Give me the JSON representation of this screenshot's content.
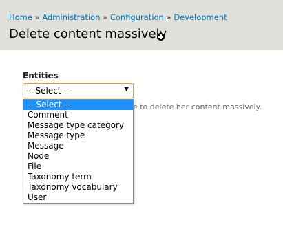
{
  "breadcrumb": {
    "items": [
      "Home",
      "Administration",
      "Configuration",
      "Development"
    ],
    "separator": "»"
  },
  "page": {
    "title": "Delete content massively",
    "shortcut_icon": "add-shortcut-icon"
  },
  "form": {
    "entities_label": "Entities",
    "select_value": "-- Select --",
    "description": "ke to delete her content massively."
  },
  "dropdown": {
    "options": [
      "-- Select --",
      "Comment",
      "Message type category",
      "Message type",
      "Message",
      "Node",
      "File",
      "Taxonomy term",
      "Taxonomy vocabulary",
      "User"
    ],
    "selected_index": 0
  },
  "colors": {
    "header_bg": "#e1e1db",
    "link": "#0074bd",
    "selected_bg": "#1e90ff",
    "focus_border": "#d1a447"
  }
}
